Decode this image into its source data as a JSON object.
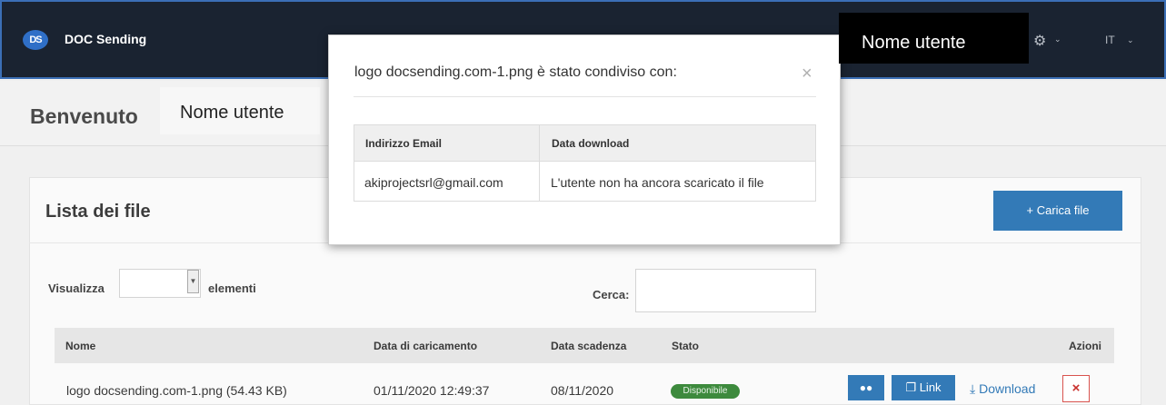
{
  "navbar": {
    "logo_text": "DS",
    "brand": "DOC Sending",
    "settings_icon": "gear-icon",
    "language": "IT",
    "user_name": "Nome utente"
  },
  "page": {
    "title": "Benvenuto",
    "user_name": "Nome utente"
  },
  "file_list": {
    "title": "Lista dei file",
    "upload_label": "+ Carica file",
    "show_label": "Visualizza",
    "show_suffix": "elementi",
    "search_label": "Cerca:",
    "search_value": "",
    "columns": [
      "Nome",
      "Data di caricamento",
      "Data scadenza",
      "Stato",
      "Azioni"
    ],
    "rows": [
      {
        "name": "logo docsending.com-1.png (54.43 KB)",
        "uploaded": "01/11/2020 12:49:37",
        "expires": "08/11/2020",
        "status": "Disponibile",
        "link_label": "Link",
        "download_label": "Download",
        "delete_label": "×"
      }
    ]
  },
  "modal": {
    "title": "logo docsending.com-1.png è stato condiviso con:",
    "close_label": "×",
    "columns": [
      "Indirizzo Email",
      "Data download"
    ],
    "rows": [
      {
        "email": "akiprojectsrl@gmail.com",
        "download_date": "L'utente non ha ancora scaricato il file"
      }
    ]
  },
  "colors": {
    "navbar": "#1a2331",
    "primary": "#337ab7",
    "status_available": "#3d8a3d",
    "danger": "#d9534f"
  }
}
